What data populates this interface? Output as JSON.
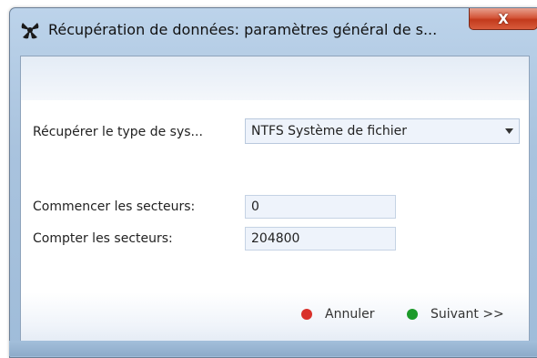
{
  "window": {
    "title": "Récupération de données: paramètres général de s...",
    "close_label": "X"
  },
  "form": {
    "fs_type_label": "Récupérer le type de sys...",
    "fs_type_value": "NTFS Système de fichier",
    "start_sectors_label": "Commencer les secteurs:",
    "start_sectors_value": "0",
    "count_sectors_label": "Compter les secteurs:",
    "count_sectors_value": "204800"
  },
  "buttons": {
    "cancel_label": "Annuler",
    "next_label": "Suivant >>"
  },
  "colors": {
    "cancel_dot": "#d9312b",
    "next_dot": "#1c9a2a"
  },
  "icons": {
    "app": "recovery-app-icon",
    "dropdown": "chevron-down-icon"
  }
}
